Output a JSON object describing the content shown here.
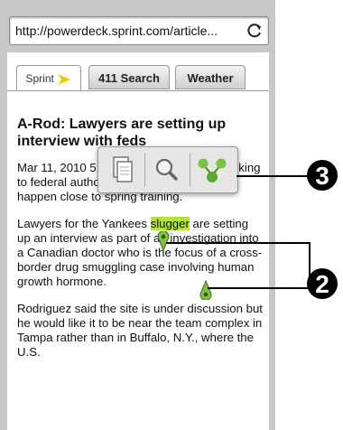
{
  "browser": {
    "url": "http://powerdeck.sprint.com/article...",
    "refresh_icon": "refresh-icon"
  },
  "tabs": [
    {
      "label": "Sprint",
      "active": true
    },
    {
      "label": "411 Search",
      "active": false
    },
    {
      "label": "Weather",
      "active": false
    }
  ],
  "article": {
    "headline": "A-Rod: Lawyers are setting up interview with feds",
    "para1": "Mar 11, 2010 5:... TAMPA, Fla. - A... be talking to federal authorities, and he hopes it will happen close to spring training.",
    "para2_pre": "Lawyers for the Yankees ",
    "para2_hl": "slugger",
    "para2_post": " are setting up an interview as part of an investigation into a Canadian doctor who is the focus of a cross-border drug smuggling case involving human growth hormone.",
    "para3": "Rodriguez said the site is under discussion but he would like it to be near the team complex in Tampa rather than in Buffalo, N.Y., where the U.S."
  },
  "selection_toolbar": {
    "icons": [
      "copy-icon",
      "search-icon",
      "share-icon"
    ]
  },
  "callouts": {
    "badge_top": "3",
    "badge_bottom": "2"
  },
  "colors": {
    "highlight": "#b4e43a",
    "handle": "#7cc242",
    "sprint_yellow": "#f5c400"
  }
}
